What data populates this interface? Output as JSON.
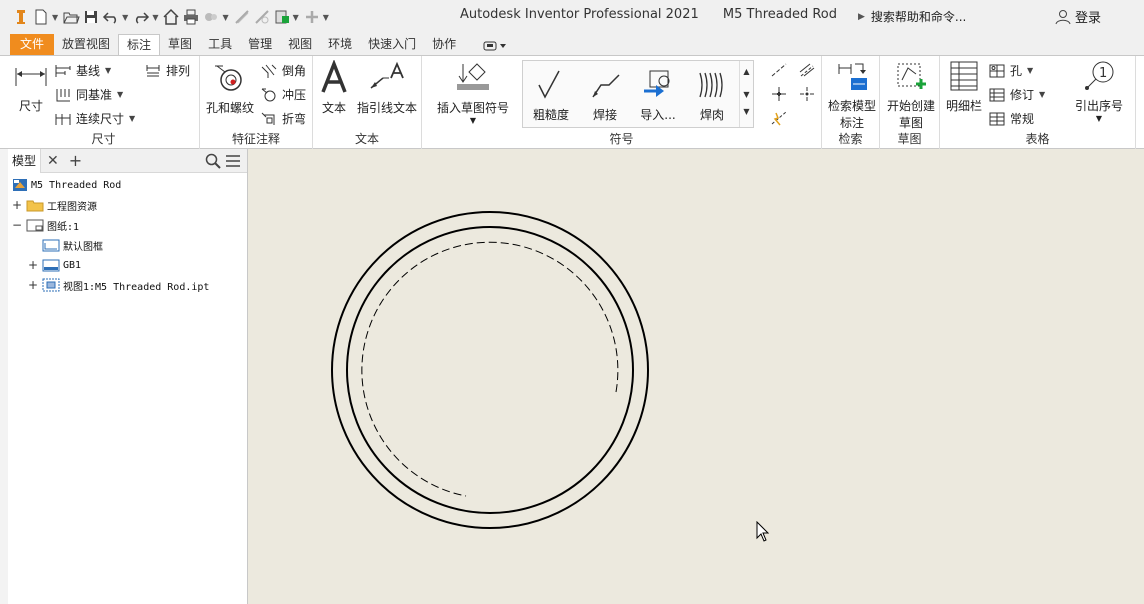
{
  "titlebar": {
    "app_name": "Autodesk Inventor Professional 2021",
    "document": "M5 Threaded Rod",
    "search_placeholder": "搜索帮助和命令...",
    "login": "登录"
  },
  "tabs": [
    "文件",
    "放置视图",
    "标注",
    "草图",
    "工具",
    "管理",
    "视图",
    "环境",
    "快速入门",
    "协作"
  ],
  "active_tab": "标注",
  "ribbon": {
    "dimension": {
      "label": "尺寸",
      "dimension_button": "尺寸",
      "baseline": "基线",
      "ordinate": "同基准",
      "chain": "连续尺寸",
      "arrange": "排列"
    },
    "feature_notes": {
      "label": "特征注释",
      "hole_thread": "孔和螺纹",
      "chamfer": "倒角",
      "punch": "冲压",
      "bend": "折弯"
    },
    "text": {
      "label": "文本",
      "text_button": "文本",
      "leader_text": "指引线文本"
    },
    "symbols": {
      "label": "符号",
      "insert_sketch_symbol": "插入草图符号",
      "surface": "粗糙度",
      "weld": "焊接",
      "import": "导入...",
      "caterpillar": "焊肉"
    },
    "retrieve": {
      "label": "检索",
      "retrieve_model": "检索模型",
      "annotation": "标注"
    },
    "sketch": {
      "label": "草图",
      "start_sketch": "开始创建",
      "sketch_word": "草图"
    },
    "table": {
      "label": "表格",
      "parts_list": "明细栏",
      "hole": "孔",
      "revision": "修订",
      "general": "常规",
      "balloon": "引出序号"
    }
  },
  "browser": {
    "tab": "模型",
    "nodes": [
      {
        "label": "M5 Threaded Rod"
      },
      {
        "label": "工程图资源"
      },
      {
        "label": "图纸:1"
      },
      {
        "label": "默认图框"
      },
      {
        "label": "GB1"
      },
      {
        "label": "视图1:M5 Threaded Rod.ipt"
      }
    ]
  },
  "colors": {
    "file_tab": "#f08c1e",
    "canvas_bg": "#ece9de",
    "accent_blue": "#1b6fd1",
    "accent_green": "#1aa33a"
  }
}
